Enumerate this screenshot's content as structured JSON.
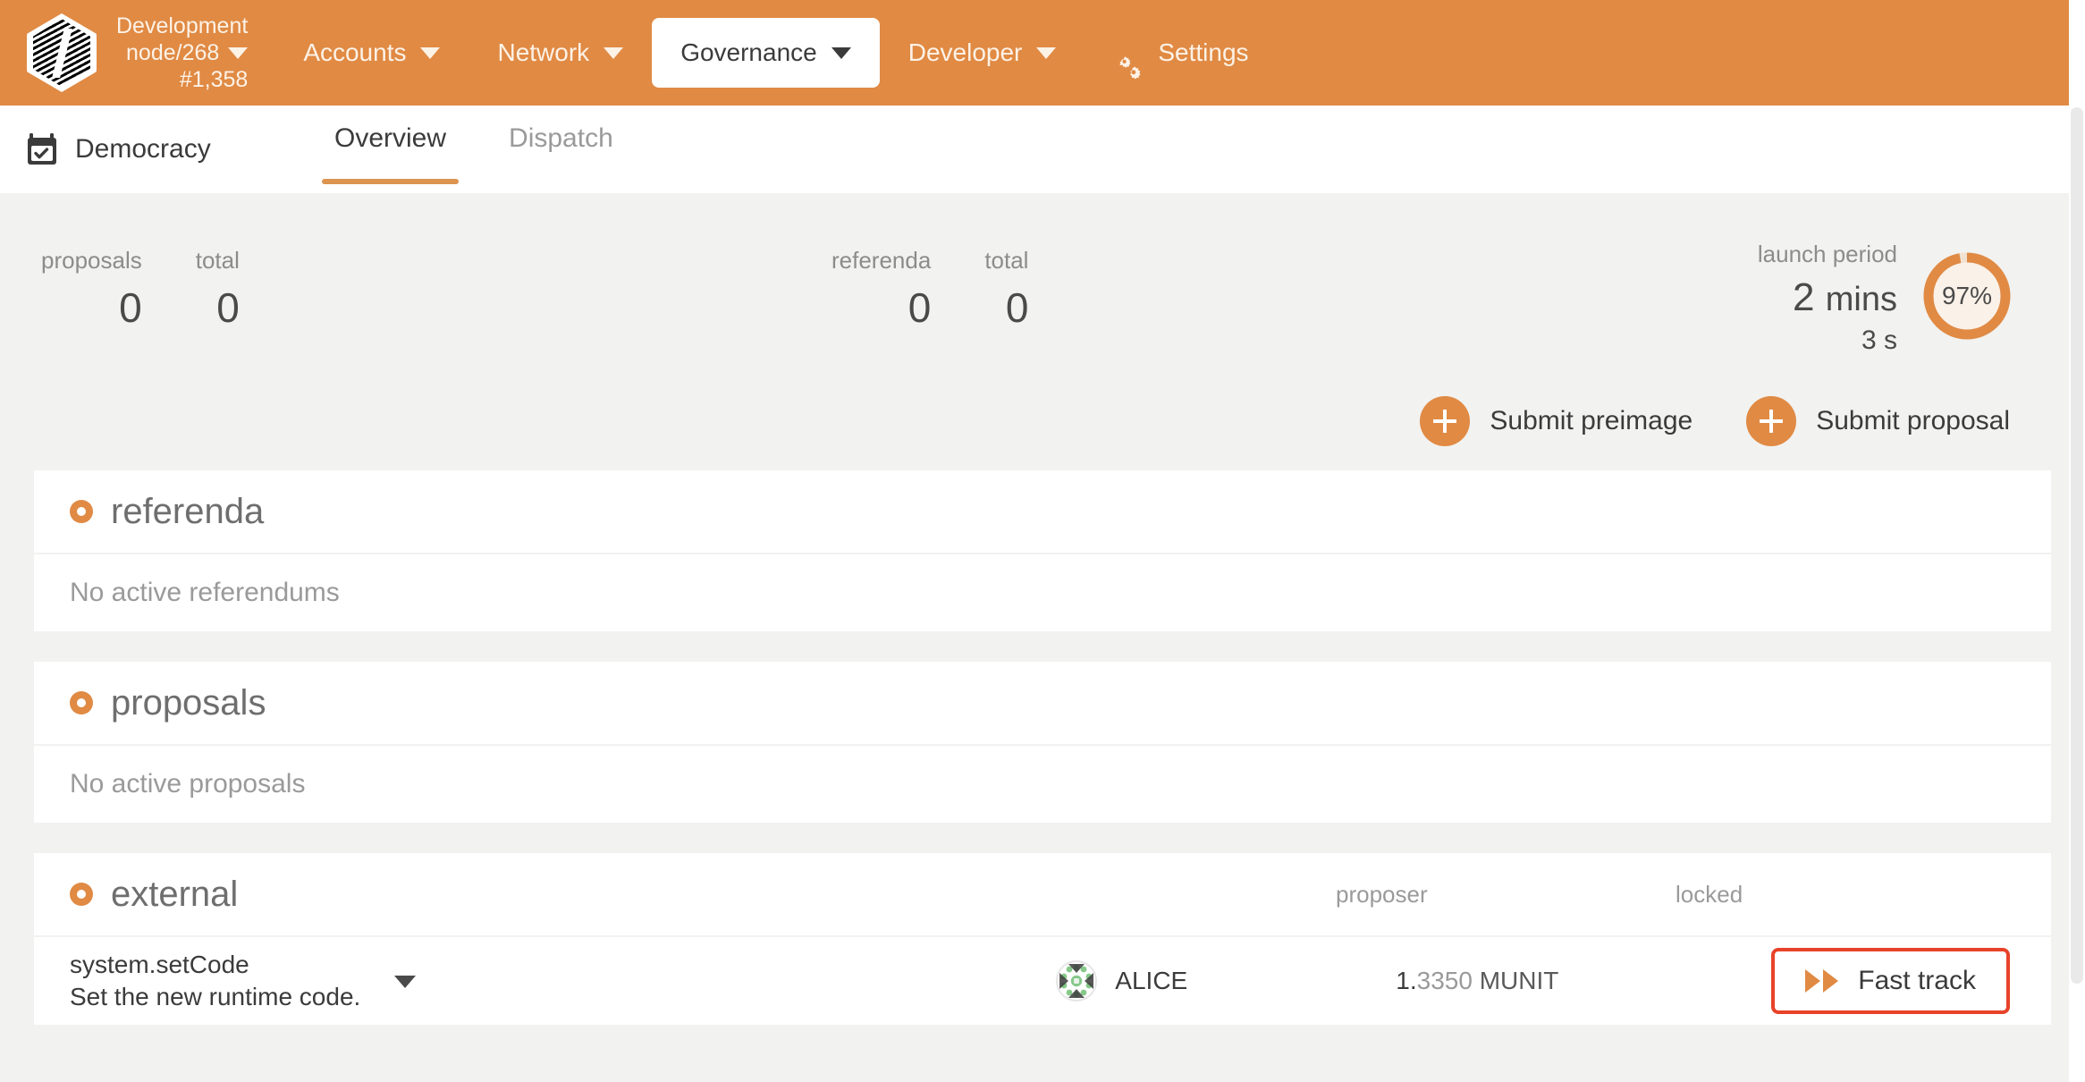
{
  "topbar": {
    "logo_icon": "substrate-hex-logo",
    "chain_line1": "Development",
    "chain_line2": "node/268",
    "chain_line3": "#1,358",
    "chain_caret_icon": "chevron-down-icon",
    "nav": [
      {
        "label": "Accounts",
        "caret_icon": "chevron-down-icon",
        "active": false
      },
      {
        "label": "Network",
        "caret_icon": "chevron-down-icon",
        "active": false
      },
      {
        "label": "Governance",
        "caret_icon": "chevron-down-icon",
        "active": true
      },
      {
        "label": "Developer",
        "caret_icon": "chevron-down-icon",
        "active": false
      },
      {
        "label": "Settings",
        "icon": "gear-icon",
        "active": false
      }
    ]
  },
  "subbar": {
    "breadcrumb_icon": "calendar-check-icon",
    "breadcrumb": "Democracy",
    "tabs": [
      {
        "label": "Overview",
        "active": true
      },
      {
        "label": "Dispatch",
        "active": false
      }
    ],
    "help_label": "?"
  },
  "summary": {
    "proposals": {
      "label": "proposals",
      "value": "0"
    },
    "proposals_total": {
      "label": "total",
      "value": "0"
    },
    "referenda": {
      "label": "referenda",
      "value": "0"
    },
    "referenda_total": {
      "label": "total",
      "value": "0"
    },
    "launch": {
      "label": "launch period",
      "time_value": "2",
      "time_unit": "mins",
      "sub": "3 s",
      "percent": "97%",
      "percent_value": 97,
      "accent": "#e08a44"
    }
  },
  "actions": {
    "submit_preimage": "Submit preimage",
    "submit_proposal": "Submit proposal",
    "plus_icon": "plus-circle-icon"
  },
  "sections": [
    {
      "icon": "dot-circle-icon",
      "title": "referenda",
      "empty": "No active referendums"
    },
    {
      "icon": "dot-circle-icon",
      "title": "proposals",
      "empty": "No active proposals"
    }
  ],
  "external": {
    "icon": "dot-circle-icon",
    "title": "external",
    "columns": {
      "proposer": "proposer",
      "locked": "locked"
    },
    "row": {
      "call": "system.setCode",
      "description": "Set the new runtime code.",
      "expand_icon": "chevron-down-icon",
      "proposer_icon": "identicon-avatar",
      "proposer": "ALICE",
      "locked_int": "1.",
      "locked_frac": "3350",
      "locked_unit": "MUNIT",
      "action_icon": "fast-forward-icon",
      "action_label": "Fast track",
      "highlight_color": "#e8432a"
    }
  }
}
